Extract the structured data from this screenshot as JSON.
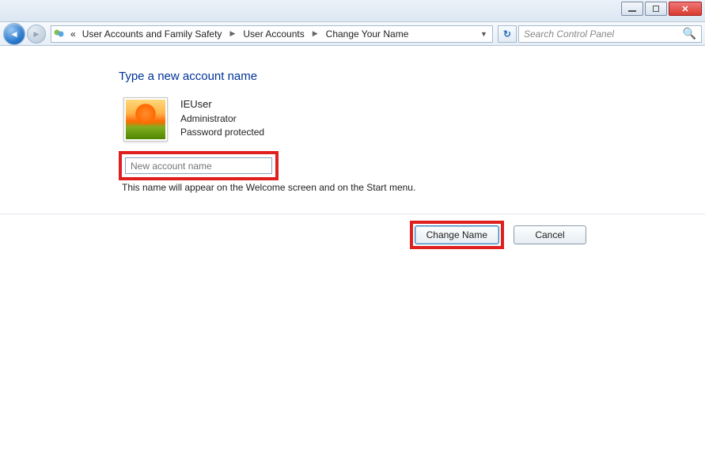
{
  "window": {
    "minimize": "—",
    "maximize": "□",
    "close": "✕"
  },
  "nav": {
    "back_glyph": "◄",
    "fwd_glyph": "►",
    "refresh_glyph": "↻"
  },
  "breadcrumb": {
    "prefix_chevrons": "«",
    "items": [
      "User Accounts and Family Safety",
      "User Accounts",
      "Change Your Name"
    ]
  },
  "search": {
    "placeholder": "Search Control Panel"
  },
  "page": {
    "heading": "Type a new account name",
    "helper": "This name will appear on the Welcome screen and on the Start menu."
  },
  "user": {
    "name": "IEUser",
    "role": "Administrator",
    "protection": "Password protected"
  },
  "input": {
    "placeholder": "New account name",
    "value": ""
  },
  "buttons": {
    "change": "Change Name",
    "cancel": "Cancel"
  }
}
